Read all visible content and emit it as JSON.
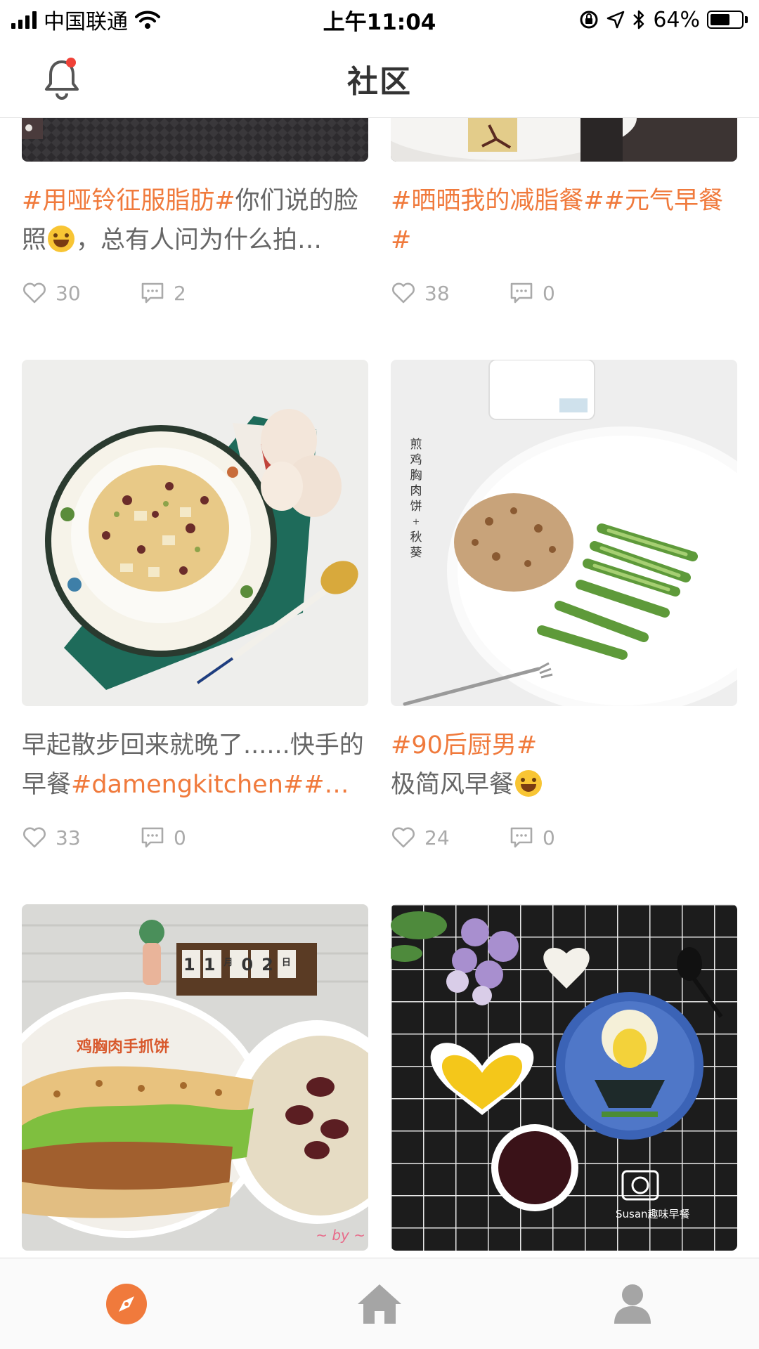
{
  "status_bar": {
    "carrier": "中国联通",
    "time": "上午11:04",
    "battery_percent": "64%",
    "battery_level": 0.64
  },
  "header": {
    "title": "社区",
    "notification_icon": "bell-icon",
    "has_unread": true
  },
  "posts": [
    {
      "tag": "#用哑铃征服脂肪#",
      "text_before_emoji": "你们说的脸照",
      "emoji": "joy-emoji",
      "text_after_emoji": "，总有人问为什么拍…",
      "likes": "30",
      "comments": "2"
    },
    {
      "tag": "#晒晒我的减脂餐##元气早餐#",
      "text": "",
      "likes": "38",
      "comments": "0"
    },
    {
      "text": "早起散步回来就晚了......快手的早餐",
      "tag": "#damengkitchen##…",
      "likes": "33",
      "comments": "0"
    },
    {
      "tag": "#90后厨男#",
      "text": "极简风早餐",
      "emoji": "grin-emoji",
      "likes": "24",
      "comments": "0",
      "image_text": [
        "煎",
        "鸡",
        "胸",
        "肉",
        "饼",
        "+",
        "秋",
        "葵"
      ]
    },
    {
      "image_text_main": "鸡胸肉手抓饼",
      "image_calendar": [
        "1",
        "1",
        "月",
        "0",
        "2",
        "日"
      ],
      "image_signature": "~ by ~"
    },
    {
      "image_watermark": "Susan趣味早餐"
    }
  ],
  "tab_bar": {
    "items": [
      {
        "icon": "compass-icon",
        "active": true
      },
      {
        "icon": "home-icon",
        "active": false
      },
      {
        "icon": "profile-icon",
        "active": false
      }
    ],
    "accent_color": "#f07a3c"
  },
  "colors": {
    "accent": "#f07a3c",
    "text": "#666666",
    "muted": "#aaaaaa",
    "badge": "#f04137"
  }
}
